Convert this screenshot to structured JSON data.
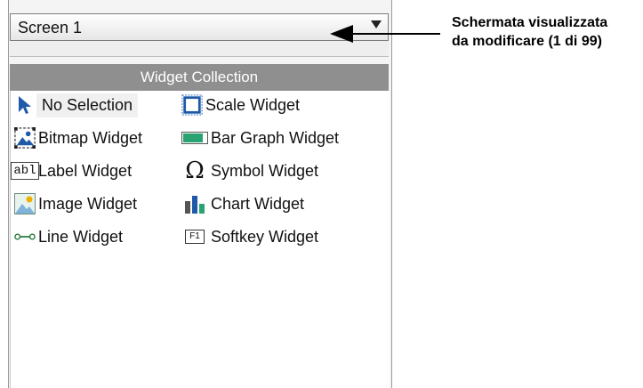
{
  "dropdown": {
    "value": "Screen 1"
  },
  "panel": {
    "header": "Widget Collection",
    "widgets": [
      {
        "label": "No Selection",
        "icon": "cursor-arrow-icon",
        "selected": true
      },
      {
        "label": "Scale Widget",
        "icon": "scale-icon"
      },
      {
        "label": "Bitmap Widget",
        "icon": "bitmap-icon"
      },
      {
        "label": "Bar Graph Widget",
        "icon": "bar-graph-icon"
      },
      {
        "label": "Label Widget",
        "icon": "label-icon",
        "icon_text": "abl"
      },
      {
        "label": "Symbol Widget",
        "icon": "omega-icon",
        "icon_text": "Ω"
      },
      {
        "label": "Image Widget",
        "icon": "image-icon"
      },
      {
        "label": "Chart Widget",
        "icon": "chart-icon"
      },
      {
        "label": "Line Widget",
        "icon": "line-icon"
      },
      {
        "label": "Softkey Widget",
        "icon": "softkey-icon",
        "icon_text": "F1"
      }
    ]
  },
  "callout": {
    "line1": "Schermata visualizzata",
    "line2": "da modificare (1 di 99)"
  },
  "colors": {
    "header_bg": "#8f8f8f",
    "selection_bg": "#f0f0f0",
    "blue_icon": "#1f5aa8"
  }
}
